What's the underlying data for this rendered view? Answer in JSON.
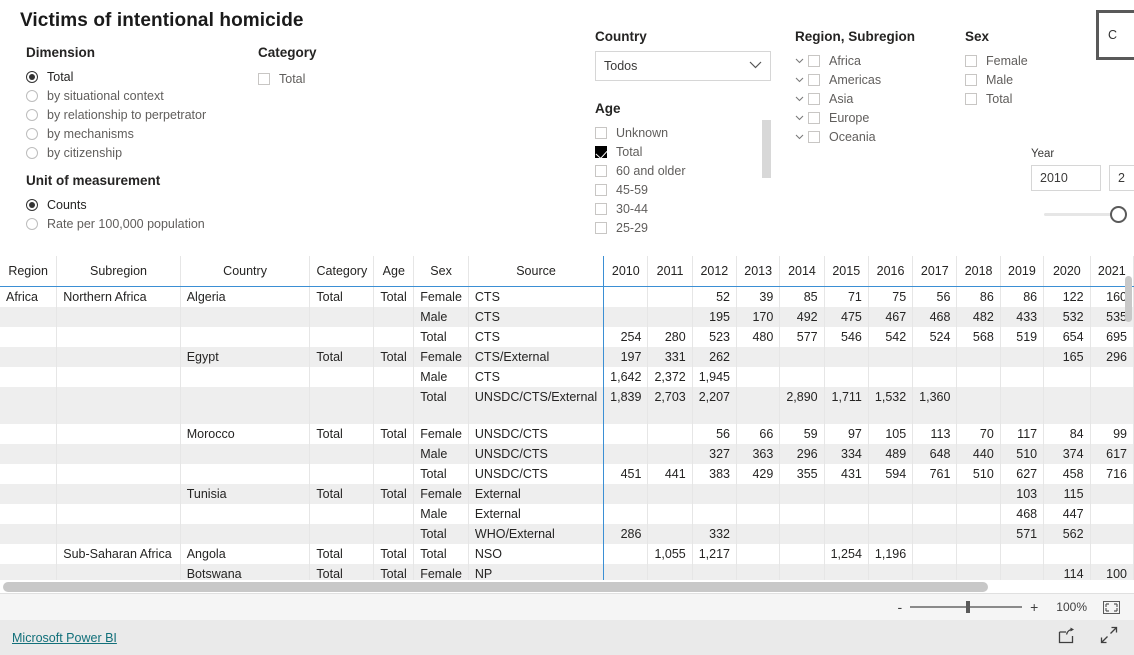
{
  "report": {
    "title": "Victims of intentional homicide"
  },
  "filters": {
    "dimension": {
      "label": "Dimension",
      "options": [
        {
          "label": "Total",
          "selected": true
        },
        {
          "label": "by situational context",
          "selected": false
        },
        {
          "label": "by relationship to perpetrator",
          "selected": false
        },
        {
          "label": "by mechanisms",
          "selected": false
        },
        {
          "label": "by citizenship",
          "selected": false
        }
      ]
    },
    "unit": {
      "label": "Unit of measurement",
      "options": [
        {
          "label": "Counts",
          "selected": true
        },
        {
          "label": "Rate per 100,000 population",
          "selected": false
        }
      ]
    },
    "category": {
      "label": "Category",
      "options": [
        {
          "label": "Total",
          "checked": false
        }
      ]
    },
    "country": {
      "label": "Country",
      "selected_value": "Todos",
      "caret_icon": "chevron-down-icon"
    },
    "age": {
      "label": "Age",
      "options": [
        {
          "label": "Unknown",
          "checked": false
        },
        {
          "label": "Total",
          "checked": true
        },
        {
          "label": "60 and older",
          "checked": false
        },
        {
          "label": "45-59",
          "checked": false
        },
        {
          "label": "30-44",
          "checked": false
        },
        {
          "label": "25-29",
          "checked": false
        }
      ]
    },
    "region": {
      "label": "Region, Subregion",
      "options": [
        {
          "label": "Africa",
          "checked": false,
          "expandable": true
        },
        {
          "label": "Americas",
          "checked": false,
          "expandable": true
        },
        {
          "label": "Asia",
          "checked": false,
          "expandable": true
        },
        {
          "label": "Europe",
          "checked": false,
          "expandable": true
        },
        {
          "label": "Oceania",
          "checked": false,
          "expandable": true
        }
      ]
    },
    "sex": {
      "label": "Sex",
      "options": [
        {
          "label": "Female",
          "checked": false
        },
        {
          "label": "Male",
          "checked": false
        },
        {
          "label": "Total",
          "checked": false
        }
      ]
    },
    "year": {
      "label": "Year",
      "from": "2010",
      "to": "2"
    },
    "cut_button": {
      "label": "C"
    }
  },
  "table": {
    "columns": [
      "Region",
      "Subregion",
      "Country",
      "Category",
      "Age",
      "Sex",
      "Source"
    ],
    "year_columns": [
      "2010",
      "2011",
      "2012",
      "2013",
      "2014",
      "2015",
      "2016",
      "2017",
      "2018",
      "2019",
      "2020",
      "2021"
    ],
    "rows": [
      {
        "region": "Africa",
        "subregion": "Northern Africa",
        "country": "Algeria",
        "category": "Total",
        "age": "Total",
        "sex": "Female",
        "source": "CTS",
        "values": [
          "",
          "",
          "52",
          "39",
          "85",
          "71",
          "75",
          "56",
          "86",
          "86",
          "122",
          "160"
        ]
      },
      {
        "region": "",
        "subregion": "",
        "country": "",
        "category": "",
        "age": "",
        "sex": "Male",
        "source": "CTS",
        "values": [
          "",
          "",
          "195",
          "170",
          "492",
          "475",
          "467",
          "468",
          "482",
          "433",
          "532",
          "535"
        ]
      },
      {
        "region": "",
        "subregion": "",
        "country": "",
        "category": "",
        "age": "",
        "sex": "Total",
        "source": "CTS",
        "values": [
          "254",
          "280",
          "523",
          "480",
          "577",
          "546",
          "542",
          "524",
          "568",
          "519",
          "654",
          "695"
        ]
      },
      {
        "region": "",
        "subregion": "",
        "country": "Egypt",
        "category": "Total",
        "age": "Total",
        "sex": "Female",
        "source": "CTS/External",
        "values": [
          "197",
          "331",
          "262",
          "",
          "",
          "",
          "",
          "",
          "",
          "",
          "165",
          "296"
        ]
      },
      {
        "region": "",
        "subregion": "",
        "country": "",
        "category": "",
        "age": "",
        "sex": "Male",
        "source": "CTS",
        "values": [
          "1,642",
          "2,372",
          "1,945",
          "",
          "",
          "",
          "",
          "",
          "",
          "",
          "",
          ""
        ]
      },
      {
        "region": "",
        "subregion": "",
        "country": "",
        "category": "",
        "age": "",
        "sex": "Total",
        "source": "UNSDC/CTS/External",
        "values": [
          "1,839",
          "2,703",
          "2,207",
          "",
          "2,890",
          "1,711",
          "1,532",
          "1,360",
          "",
          "",
          "",
          ""
        ]
      },
      {
        "region": "",
        "subregion": "",
        "country": "Morocco",
        "category": "Total",
        "age": "Total",
        "sex": "Female",
        "source": "UNSDC/CTS",
        "values": [
          "",
          "",
          "56",
          "66",
          "59",
          "97",
          "105",
          "113",
          "70",
          "117",
          "84",
          "99"
        ]
      },
      {
        "region": "",
        "subregion": "",
        "country": "",
        "category": "",
        "age": "",
        "sex": "Male",
        "source": "UNSDC/CTS",
        "values": [
          "",
          "",
          "327",
          "363",
          "296",
          "334",
          "489",
          "648",
          "440",
          "510",
          "374",
          "617"
        ]
      },
      {
        "region": "",
        "subregion": "",
        "country": "",
        "category": "",
        "age": "",
        "sex": "Total",
        "source": "UNSDC/CTS",
        "values": [
          "451",
          "441",
          "383",
          "429",
          "355",
          "431",
          "594",
          "761",
          "510",
          "627",
          "458",
          "716"
        ]
      },
      {
        "region": "",
        "subregion": "",
        "country": "Tunisia",
        "category": "Total",
        "age": "Total",
        "sex": "Female",
        "source": "External",
        "values": [
          "",
          "",
          "",
          "",
          "",
          "",
          "",
          "",
          "",
          "103",
          "115",
          ""
        ]
      },
      {
        "region": "",
        "subregion": "",
        "country": "",
        "category": "",
        "age": "",
        "sex": "Male",
        "source": "External",
        "values": [
          "",
          "",
          "",
          "",
          "",
          "",
          "",
          "",
          "",
          "468",
          "447",
          ""
        ]
      },
      {
        "region": "",
        "subregion": "",
        "country": "",
        "category": "",
        "age": "",
        "sex": "Total",
        "source": "WHO/External",
        "values": [
          "286",
          "",
          "332",
          "",
          "",
          "",
          "",
          "",
          "",
          "571",
          "562",
          ""
        ]
      },
      {
        "region": "",
        "subregion": "Sub-Saharan Africa",
        "country": "Angola",
        "category": "Total",
        "age": "Total",
        "sex": "Total",
        "source": "NSO",
        "values": [
          "",
          "1,055",
          "1,217",
          "",
          "",
          "1,254",
          "1,196",
          "",
          "",
          "",
          "",
          ""
        ]
      },
      {
        "region": "",
        "subregion": "",
        "country": "Botswana",
        "category": "Total",
        "age": "Total",
        "sex": "Female",
        "source": "NP",
        "values": [
          "",
          "",
          "",
          "",
          "",
          "",
          "",
          "",
          "",
          "",
          "114",
          "100"
        ]
      }
    ]
  },
  "zoombar": {
    "minus_label": "-",
    "plus_label": "+",
    "percent": "100%",
    "fit_icon": "fit-to-page-icon"
  },
  "footer": {
    "link": "Microsoft Power BI",
    "share_icon": "share-icon",
    "fullscreen_icon": "fullscreen-icon"
  }
}
